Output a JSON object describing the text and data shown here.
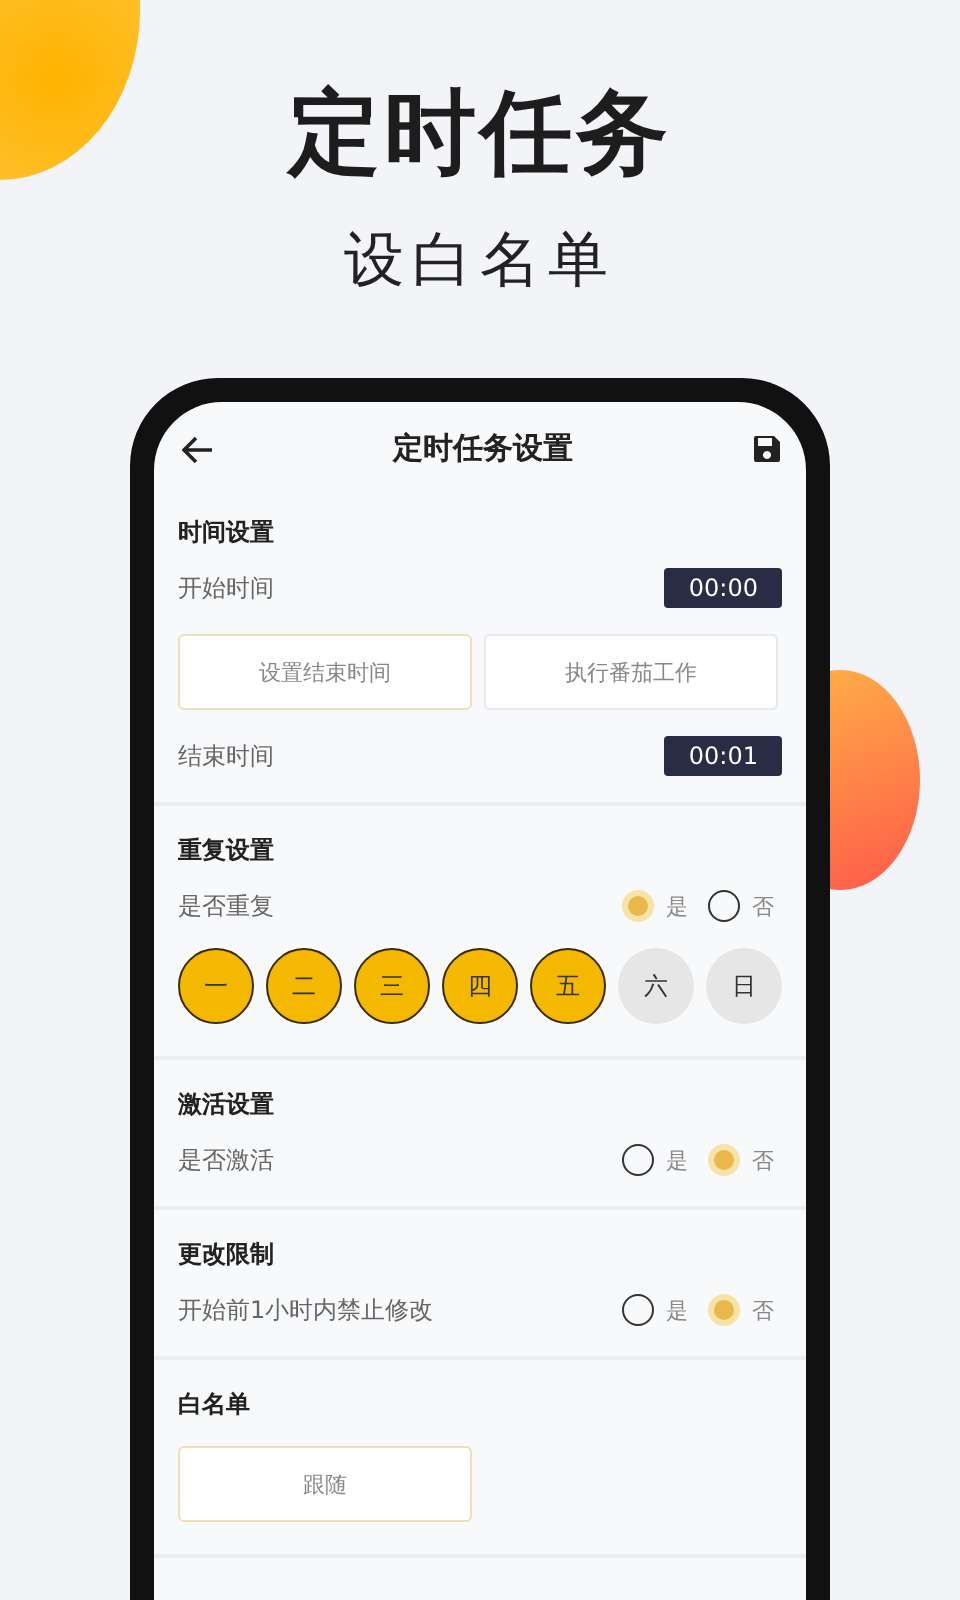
{
  "hero": {
    "title": "定时任务",
    "subtitle": "设白名单"
  },
  "screen": {
    "title": "定时任务设置",
    "sections": [
      {
        "heading": "时间设置",
        "rows": [
          {
            "kind": "time",
            "label": "开始时间",
            "value": "00:00"
          },
          {
            "kind": "buttons",
            "buttons": [
              {
                "label": "设置结束时间",
                "selected": true
              },
              {
                "label": "执行番茄工作",
                "selected": false
              }
            ]
          },
          {
            "kind": "time",
            "label": "结束时间",
            "value": "00:01"
          }
        ]
      },
      {
        "heading": "重复设置",
        "rows": [
          {
            "kind": "radio",
            "label": "是否重复",
            "options": [
              {
                "label": "是",
                "selected": true
              },
              {
                "label": "否",
                "selected": false
              }
            ]
          },
          {
            "kind": "days",
            "days": [
              {
                "label": "一",
                "selected": true
              },
              {
                "label": "二",
                "selected": true
              },
              {
                "label": "三",
                "selected": true
              },
              {
                "label": "四",
                "selected": true
              },
              {
                "label": "五",
                "selected": true
              },
              {
                "label": "六",
                "selected": false
              },
              {
                "label": "日",
                "selected": false
              }
            ]
          }
        ]
      },
      {
        "heading": "激活设置",
        "rows": [
          {
            "kind": "radio",
            "label": "是否激活",
            "options": [
              {
                "label": "是",
                "selected": false
              },
              {
                "label": "否",
                "selected": true
              }
            ]
          }
        ]
      },
      {
        "heading": "更改限制",
        "rows": [
          {
            "kind": "radio",
            "label": "开始前1小时内禁止修改",
            "options": [
              {
                "label": "是",
                "selected": false
              },
              {
                "label": "否",
                "selected": true
              }
            ]
          }
        ]
      },
      {
        "heading": "白名单",
        "rows": [
          {
            "kind": "buttons",
            "buttons": [
              {
                "label": "跟随",
                "selected": true
              }
            ]
          }
        ]
      }
    ]
  }
}
